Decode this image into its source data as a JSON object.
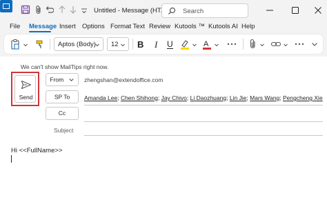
{
  "window": {
    "title": "Untitled  -  Message (HT...",
    "search_placeholder": "Search"
  },
  "menu": {
    "items": [
      "File",
      "Message",
      "Insert",
      "Options",
      "Format Text",
      "Review",
      "Kutools ™",
      "Kutools AI",
      "Help"
    ],
    "active": "Message"
  },
  "ribbon": {
    "font_name": "Aptos (Body)",
    "font_size": "12"
  },
  "compose": {
    "mailtips": "We can't show MailTips right now.",
    "send_label": "Send",
    "from_label": "From",
    "from_value": "zhengshan@extendoffice.com",
    "to_label": "SP To",
    "recipients": [
      "Amanda Lee",
      "Chen Shihong",
      "Jay Chivo",
      "Li Daozhuang",
      "Lin Jie",
      "Mars Wang",
      "Pengcheng Xie"
    ],
    "cc_label": "Cc",
    "subject_label": "Subject",
    "body_line": "Hi <<FullName>>"
  },
  "colors": {
    "accent": "#0f6cbd",
    "highlight_border": "#d13438",
    "highlight_yellow": "#ffd700",
    "font_color_red": "#d13438"
  }
}
